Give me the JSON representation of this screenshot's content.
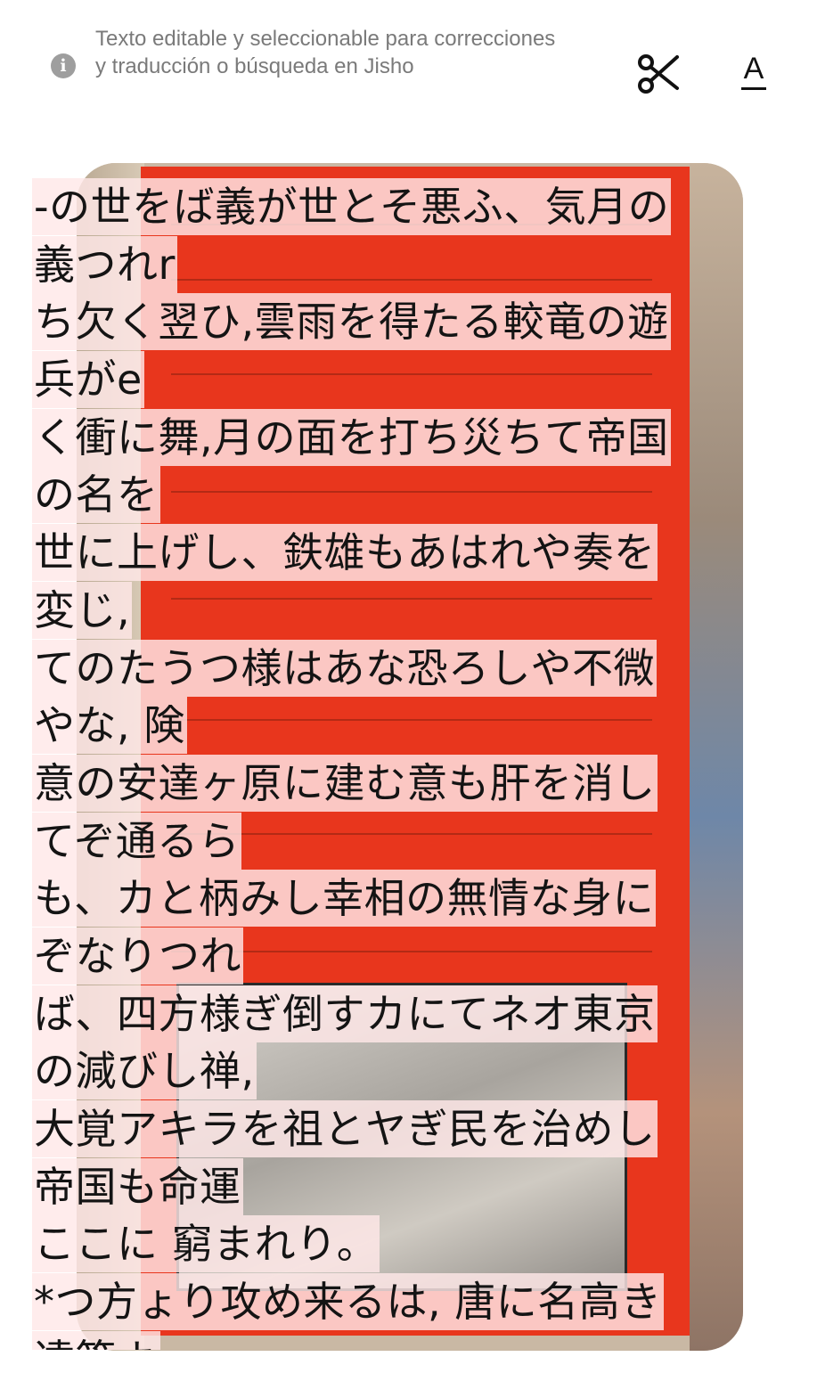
{
  "header": {
    "info_text": "Texto editable y seleccionable para correcciones y traducción o búsqueda en Jisho",
    "info_icon_glyph": "i",
    "font_button_label": "A"
  },
  "icons": {
    "info": "info-icon",
    "scissors": "scissors-icon",
    "font": "font-size-icon"
  },
  "colors": {
    "text_highlight": "#ffe8e8",
    "info_text": "#7a7a7a",
    "red_panel": "#e8361d"
  },
  "ocr_lines": [
    "-の世をば義が世とそ悪ふ、気月の",
    "義つれr",
    "ち欠く翌ひ,雲雨を得たる較竜の遊",
    "兵がe",
    "く衝に舞,月の面を打ち災ちて帝国",
    "の名を",
    "世に上げし、鉄雄もあはれや奏を",
    "変じ,",
    "てのたうつ様はあな恐ろしや不微",
    "やな, 険",
    "意の安達ヶ原に建む意も肝を消し",
    "てぞ通るら",
    "も、カと柄みし幸相の無情な身に",
    "ぞなりつれ",
    "ば、四方様ぎ倒すカにてネオ東京",
    "の減びし禅,",
    "大覚アキラを祖とヤぎ民を治めし",
    "帝国も命運",
    "ここに 窮まれり。",
    "*つ方ょり攻め来るは, 唐に名高き",
    "達策よ"
  ]
}
